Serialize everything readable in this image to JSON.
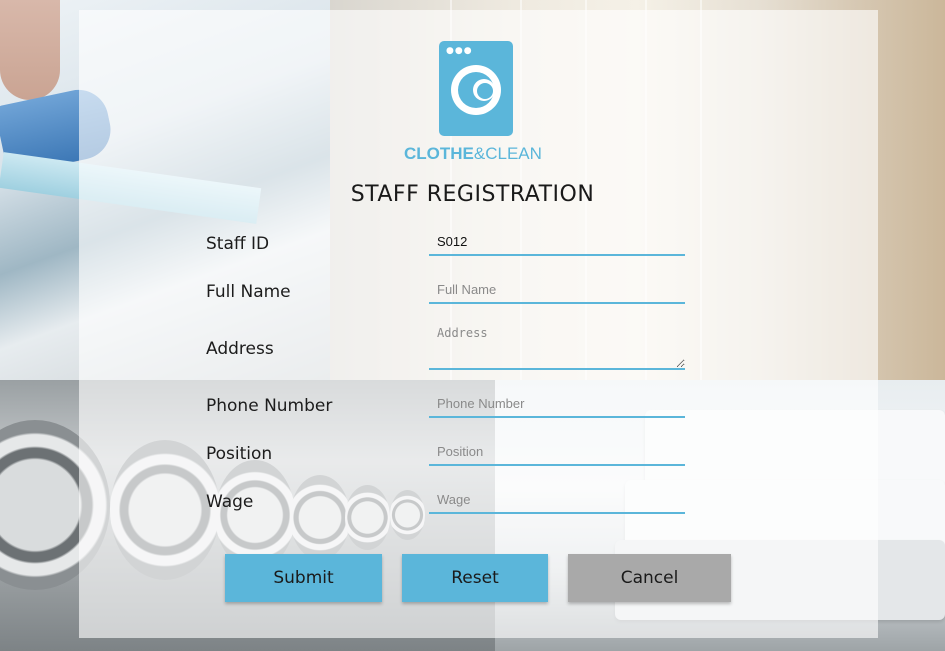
{
  "brand": {
    "name_bold": "CLOTHE",
    "name_rest": "&CLEAN",
    "color": "#5bb6da",
    "icon": "washing-machine-logo-icon"
  },
  "form": {
    "title": "STAFF REGISTRATION",
    "fields": {
      "staff_id": {
        "label": "Staff ID",
        "value": "S012",
        "placeholder": ""
      },
      "full_name": {
        "label": "Full Name",
        "value": "",
        "placeholder": "Full Name"
      },
      "address": {
        "label": "Address",
        "value": "",
        "placeholder": "Address"
      },
      "phone": {
        "label": "Phone Number",
        "value": "",
        "placeholder": "Phone Number"
      },
      "position": {
        "label": "Position",
        "value": "",
        "placeholder": "Position"
      },
      "wage": {
        "label": "Wage",
        "value": "",
        "placeholder": "Wage"
      }
    },
    "buttons": {
      "submit": "Submit",
      "reset": "Reset",
      "cancel": "Cancel"
    }
  },
  "colors": {
    "accent": "#5bb6da",
    "cancel": "#a9a9a9"
  }
}
